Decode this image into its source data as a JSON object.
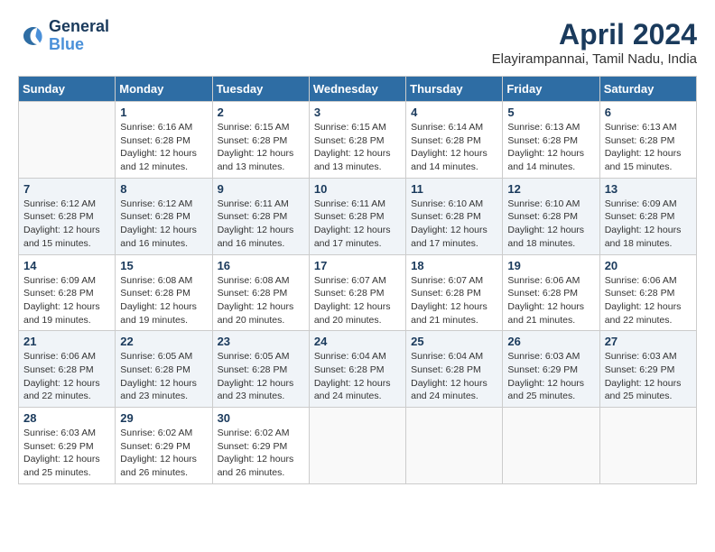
{
  "logo": {
    "line1": "General",
    "line2": "Blue"
  },
  "title": "April 2024",
  "location": "Elayirampannai, Tamil Nadu, India",
  "weekdays": [
    "Sunday",
    "Monday",
    "Tuesday",
    "Wednesday",
    "Thursday",
    "Friday",
    "Saturday"
  ],
  "weeks": [
    [
      {
        "day": "",
        "info": ""
      },
      {
        "day": "1",
        "info": "Sunrise: 6:16 AM\nSunset: 6:28 PM\nDaylight: 12 hours\nand 12 minutes."
      },
      {
        "day": "2",
        "info": "Sunrise: 6:15 AM\nSunset: 6:28 PM\nDaylight: 12 hours\nand 13 minutes."
      },
      {
        "day": "3",
        "info": "Sunrise: 6:15 AM\nSunset: 6:28 PM\nDaylight: 12 hours\nand 13 minutes."
      },
      {
        "day": "4",
        "info": "Sunrise: 6:14 AM\nSunset: 6:28 PM\nDaylight: 12 hours\nand 14 minutes."
      },
      {
        "day": "5",
        "info": "Sunrise: 6:13 AM\nSunset: 6:28 PM\nDaylight: 12 hours\nand 14 minutes."
      },
      {
        "day": "6",
        "info": "Sunrise: 6:13 AM\nSunset: 6:28 PM\nDaylight: 12 hours\nand 15 minutes."
      }
    ],
    [
      {
        "day": "7",
        "info": "Sunrise: 6:12 AM\nSunset: 6:28 PM\nDaylight: 12 hours\nand 15 minutes."
      },
      {
        "day": "8",
        "info": "Sunrise: 6:12 AM\nSunset: 6:28 PM\nDaylight: 12 hours\nand 16 minutes."
      },
      {
        "day": "9",
        "info": "Sunrise: 6:11 AM\nSunset: 6:28 PM\nDaylight: 12 hours\nand 16 minutes."
      },
      {
        "day": "10",
        "info": "Sunrise: 6:11 AM\nSunset: 6:28 PM\nDaylight: 12 hours\nand 17 minutes."
      },
      {
        "day": "11",
        "info": "Sunrise: 6:10 AM\nSunset: 6:28 PM\nDaylight: 12 hours\nand 17 minutes."
      },
      {
        "day": "12",
        "info": "Sunrise: 6:10 AM\nSunset: 6:28 PM\nDaylight: 12 hours\nand 18 minutes."
      },
      {
        "day": "13",
        "info": "Sunrise: 6:09 AM\nSunset: 6:28 PM\nDaylight: 12 hours\nand 18 minutes."
      }
    ],
    [
      {
        "day": "14",
        "info": "Sunrise: 6:09 AM\nSunset: 6:28 PM\nDaylight: 12 hours\nand 19 minutes."
      },
      {
        "day": "15",
        "info": "Sunrise: 6:08 AM\nSunset: 6:28 PM\nDaylight: 12 hours\nand 19 minutes."
      },
      {
        "day": "16",
        "info": "Sunrise: 6:08 AM\nSunset: 6:28 PM\nDaylight: 12 hours\nand 20 minutes."
      },
      {
        "day": "17",
        "info": "Sunrise: 6:07 AM\nSunset: 6:28 PM\nDaylight: 12 hours\nand 20 minutes."
      },
      {
        "day": "18",
        "info": "Sunrise: 6:07 AM\nSunset: 6:28 PM\nDaylight: 12 hours\nand 21 minutes."
      },
      {
        "day": "19",
        "info": "Sunrise: 6:06 AM\nSunset: 6:28 PM\nDaylight: 12 hours\nand 21 minutes."
      },
      {
        "day": "20",
        "info": "Sunrise: 6:06 AM\nSunset: 6:28 PM\nDaylight: 12 hours\nand 22 minutes."
      }
    ],
    [
      {
        "day": "21",
        "info": "Sunrise: 6:06 AM\nSunset: 6:28 PM\nDaylight: 12 hours\nand 22 minutes."
      },
      {
        "day": "22",
        "info": "Sunrise: 6:05 AM\nSunset: 6:28 PM\nDaylight: 12 hours\nand 23 minutes."
      },
      {
        "day": "23",
        "info": "Sunrise: 6:05 AM\nSunset: 6:28 PM\nDaylight: 12 hours\nand 23 minutes."
      },
      {
        "day": "24",
        "info": "Sunrise: 6:04 AM\nSunset: 6:28 PM\nDaylight: 12 hours\nand 24 minutes."
      },
      {
        "day": "25",
        "info": "Sunrise: 6:04 AM\nSunset: 6:28 PM\nDaylight: 12 hours\nand 24 minutes."
      },
      {
        "day": "26",
        "info": "Sunrise: 6:03 AM\nSunset: 6:29 PM\nDaylight: 12 hours\nand 25 minutes."
      },
      {
        "day": "27",
        "info": "Sunrise: 6:03 AM\nSunset: 6:29 PM\nDaylight: 12 hours\nand 25 minutes."
      }
    ],
    [
      {
        "day": "28",
        "info": "Sunrise: 6:03 AM\nSunset: 6:29 PM\nDaylight: 12 hours\nand 25 minutes."
      },
      {
        "day": "29",
        "info": "Sunrise: 6:02 AM\nSunset: 6:29 PM\nDaylight: 12 hours\nand 26 minutes."
      },
      {
        "day": "30",
        "info": "Sunrise: 6:02 AM\nSunset: 6:29 PM\nDaylight: 12 hours\nand 26 minutes."
      },
      {
        "day": "",
        "info": ""
      },
      {
        "day": "",
        "info": ""
      },
      {
        "day": "",
        "info": ""
      },
      {
        "day": "",
        "info": ""
      }
    ]
  ]
}
